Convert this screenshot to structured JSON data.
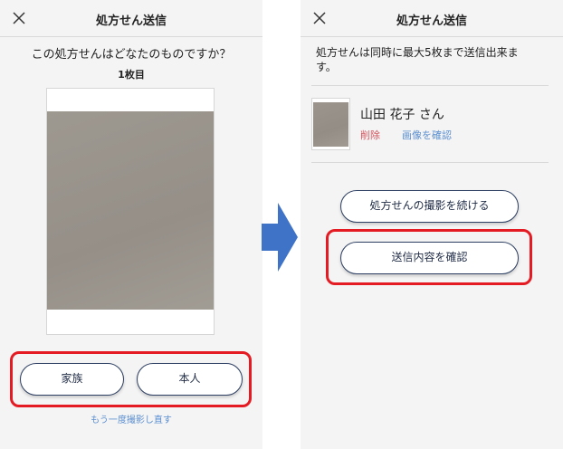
{
  "left_screen": {
    "header": {
      "title": "処方せん送信",
      "close_icon": "close-icon"
    },
    "question": "この処方せんはどなたのものですか？",
    "sheet_count": "1枚目",
    "buttons": {
      "family": "家族",
      "self": "本人"
    },
    "retake_link": "もう一度撮影し直す"
  },
  "right_screen": {
    "header": {
      "title": "処方せん送信",
      "close_icon": "close-icon"
    },
    "info_line1": "処方せんは同時に最大5枚まで送信出来ま",
    "info_line2": "す。",
    "item": {
      "patient_name": "山田 花子 さん",
      "delete_label": "削除",
      "view_label": "画像を確認"
    },
    "buttons": {
      "continue": "処方せんの撮影を続ける",
      "confirm": "送信内容を確認"
    }
  },
  "colors": {
    "highlight": "#e41b23",
    "button_border": "#2d3f63",
    "link_blue": "#5b8fd1",
    "delete_red": "#d2555e",
    "arrow_blue": "#3f73c8"
  }
}
